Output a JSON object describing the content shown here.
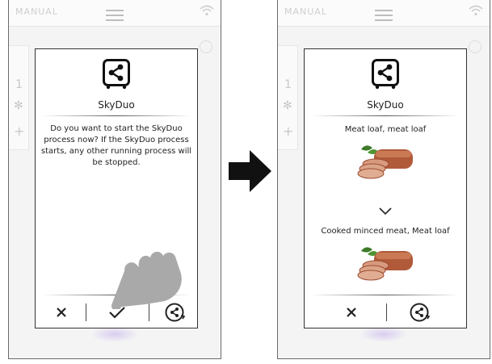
{
  "left_screen": {
    "mode_label": "MANUAL",
    "dialog": {
      "icon": "skyduo-share-icon",
      "title": "SkyDuo",
      "message": "Do you want to start the SkyDuo process now? If the SkyDuo process starts, any other running process will be stopped.",
      "actions": [
        "cancel-icon",
        "confirm-check-icon",
        "skyduo-sync-icon"
      ]
    },
    "pointer": "pointing-hand-icon"
  },
  "right_screen": {
    "mode_label": "MANUAL",
    "dialog": {
      "icon": "skyduo-share-icon",
      "title": "SkyDuo",
      "first_program": "Meat loaf, meat loaf",
      "second_program": "Cooked minced meat, Meat loaf",
      "actions": [
        "cancel-icon",
        "skyduo-sync-icon"
      ]
    }
  },
  "transition_arrow": "right-arrow-icon"
}
